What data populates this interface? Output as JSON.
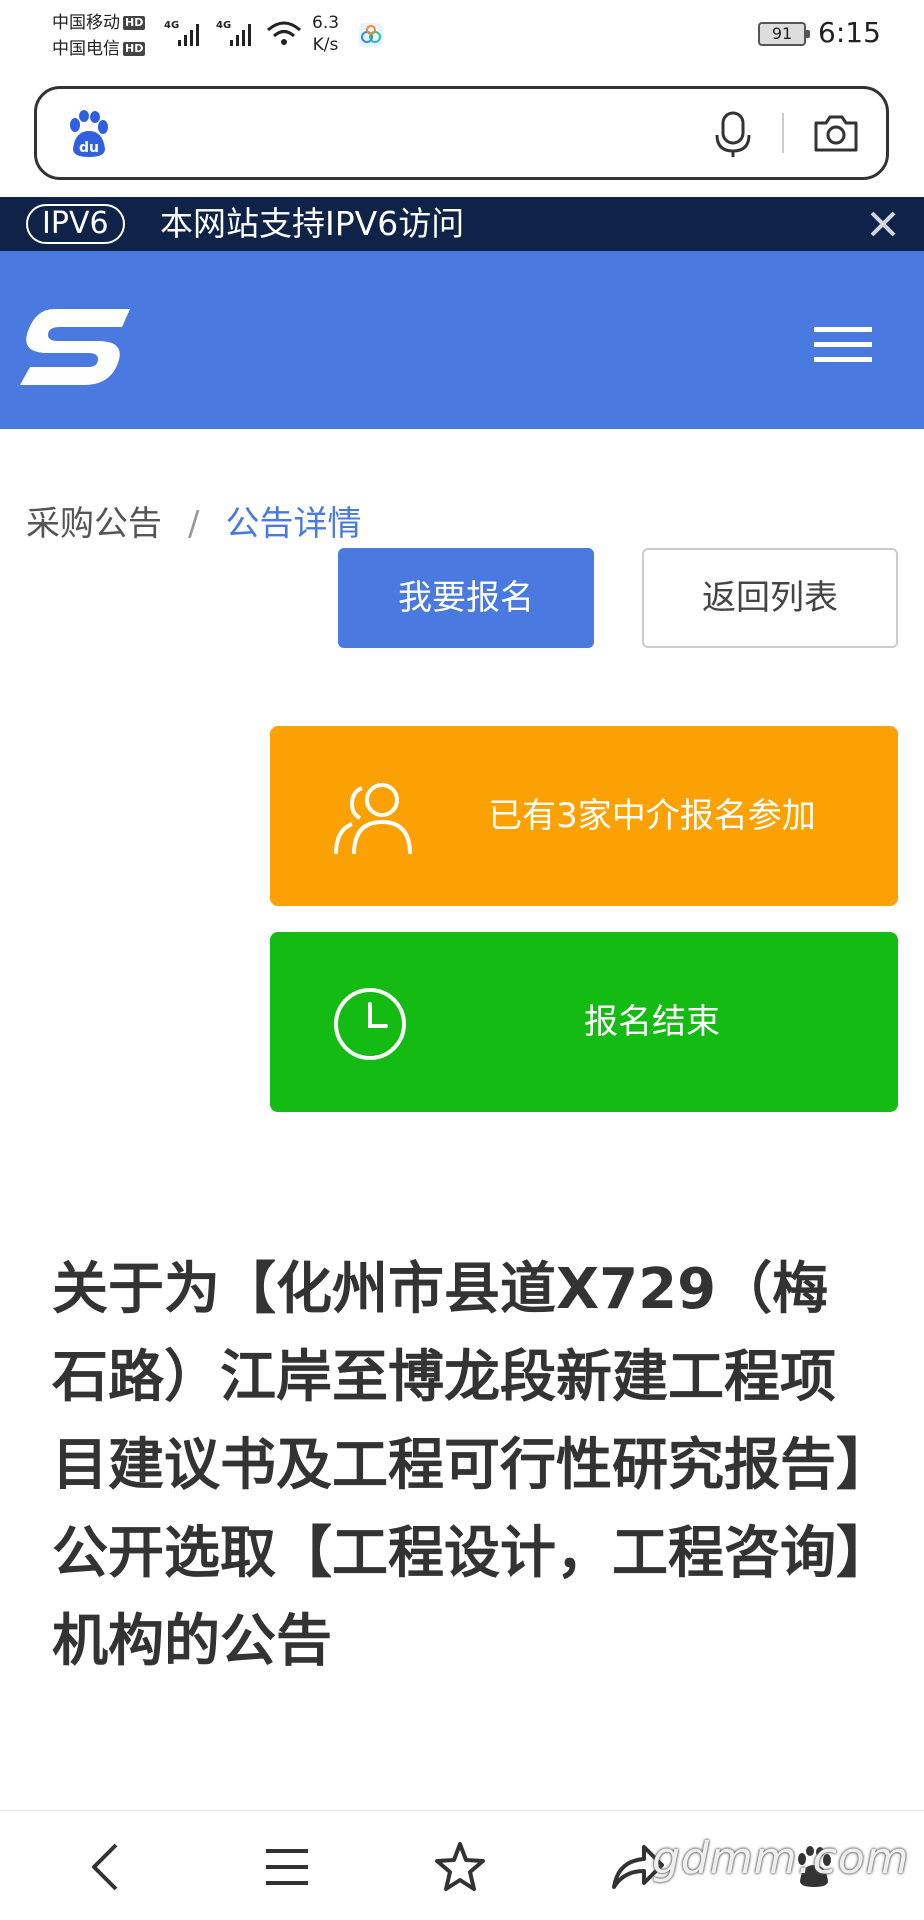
{
  "status_bar": {
    "carrier_1": "中国移动",
    "carrier_2": "中国电信",
    "hd": "HD",
    "net_1": "4G",
    "net_2": "4G",
    "speed_value": "6.3",
    "speed_unit": "K/s",
    "battery": "91",
    "time": "6:15"
  },
  "search": {
    "placeholder": "",
    "left_icon": "baidu-paw-icon",
    "right_icons": [
      "microphone-icon",
      "camera-icon"
    ]
  },
  "ipv6_banner": {
    "badge": "IPV6",
    "text": "本网站支持IPV6访问"
  },
  "breadcrumb": {
    "items": [
      "采购公告",
      "公告详情"
    ],
    "separator": "/"
  },
  "actions": {
    "register_label": "我要报名",
    "back_label": "返回列表"
  },
  "cards": {
    "participants_text": "已有3家中介报名参加",
    "status_text": "报名结束"
  },
  "article": {
    "title": "关于为【化州市县道X729（梅石路）江岸至博龙段新建工程项目建议书及工程可行性研究报告】公开选取【工程设计，工程咨询】机构的公告"
  },
  "bottom_nav": {
    "watermark": "gdmm.com",
    "icons": [
      "back-icon",
      "menu-icon",
      "star-icon",
      "share-icon",
      "baidu-home-icon"
    ]
  },
  "colors": {
    "header_blue": "#4a79e0",
    "banner_navy": "#0e2347",
    "card_orange": "#fba103",
    "card_green": "#13bb13"
  }
}
